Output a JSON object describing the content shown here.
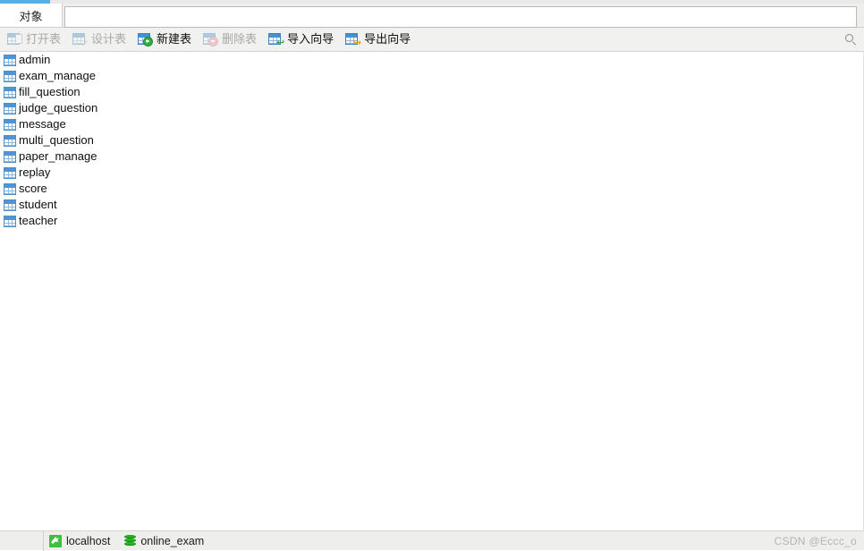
{
  "window": {
    "accent_color": "#5aaee8",
    "background": "#ffffff"
  },
  "tabbar": {
    "active_tab": "对象",
    "search": {
      "value": "",
      "placeholder": ""
    }
  },
  "toolbar": {
    "buttons": [
      {
        "label": "打开表",
        "icon": "open-table-icon",
        "enabled": false
      },
      {
        "label": "设计表",
        "icon": "design-table-icon",
        "enabled": false
      },
      {
        "label": "新建表",
        "icon": "new-table-icon",
        "enabled": true
      },
      {
        "label": "删除表",
        "icon": "delete-table-icon",
        "enabled": false
      },
      {
        "label": "导入向导",
        "icon": "import-wizard-icon",
        "enabled": true
      },
      {
        "label": "导出向导",
        "icon": "export-wizard-icon",
        "enabled": true
      }
    ],
    "search_icon": "search-icon"
  },
  "table_list": {
    "items": [
      {
        "name": "admin"
      },
      {
        "name": "exam_manage"
      },
      {
        "name": "fill_question"
      },
      {
        "name": "judge_question"
      },
      {
        "name": "message"
      },
      {
        "name": "multi_question"
      },
      {
        "name": "paper_manage"
      },
      {
        "name": "replay"
      },
      {
        "name": "score"
      },
      {
        "name": "student"
      },
      {
        "name": "teacher"
      }
    ]
  },
  "statusbar": {
    "connection": {
      "label": "localhost",
      "icon": "mysql-dolphin-icon"
    },
    "database": {
      "label": "online_exam",
      "icon": "database-icon"
    },
    "watermark": "CSDN @Eccc_o"
  }
}
